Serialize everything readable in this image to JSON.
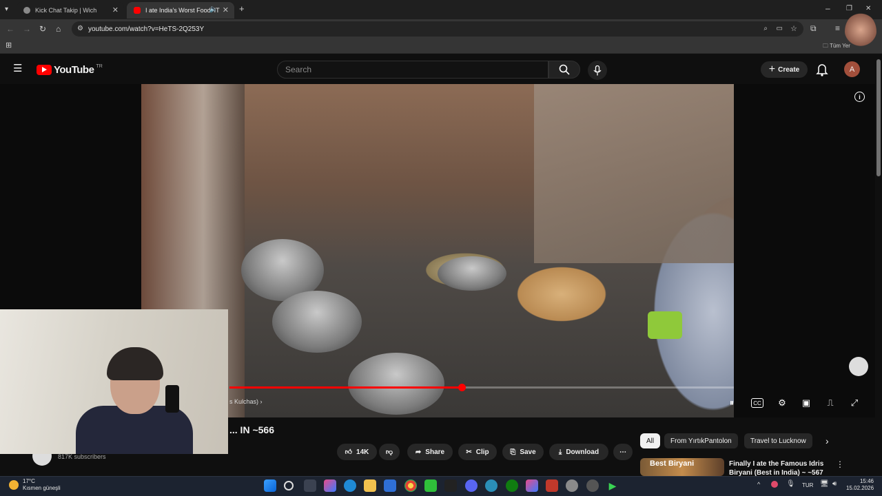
{
  "browser": {
    "tabs": [
      {
        "title": "Kick Chat Takip | Wich"
      },
      {
        "title": "I ate India's Worst Food! IT"
      }
    ],
    "url": "youtube.com/watch?v=HeTS-2Q253Y",
    "bookmarks_label": "Tüm Yer"
  },
  "youtube": {
    "logo": "YouTube",
    "region": "TR",
    "search_placeholder": "Search",
    "create_label": "Create",
    "avatar_letter": "A"
  },
  "video": {
    "chapter_text": "s Kulchas)",
    "progress": 0.46,
    "title_fragment": "... IN ~566",
    "subscribers": "817K subscribers"
  },
  "actions": {
    "like_count": "14K",
    "share": "Share",
    "clip": "Clip",
    "save": "Save",
    "download": "Download"
  },
  "chips": [
    "All",
    "From YırtıkPantolon",
    "Travel to Lucknow"
  ],
  "recommendation": {
    "thumb_text": "Best Biryani",
    "title": "Finally I ate the Famous Idris Biryani (Best in India) ~ ~567"
  },
  "taskbar": {
    "temperature": "17°C",
    "weather": "Kısmen güneşli",
    "language": "TUR",
    "time": "15:46",
    "date": "15.02.2026"
  },
  "colors": {
    "accent_red": "#ff0000",
    "background": "#0f0f0f",
    "chip_bg": "#272727"
  }
}
